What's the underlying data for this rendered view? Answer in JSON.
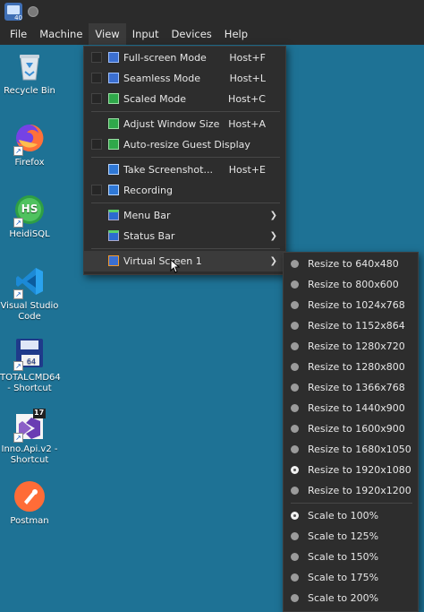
{
  "menubar": {
    "items": [
      "File",
      "Machine",
      "View",
      "Input",
      "Devices",
      "Help"
    ]
  },
  "app_icon_version": "40",
  "desktop": {
    "icons": [
      {
        "label": "Recycle Bin",
        "icon": "recycle-bin-icon"
      },
      {
        "label": "Firefox",
        "icon": "firefox-icon"
      },
      {
        "label": "HeidiSQL",
        "icon": "heidisql-icon",
        "badge": "HS"
      },
      {
        "label": "Visual Studio Code",
        "icon": "vscode-icon"
      },
      {
        "label": "TOTALCMD64 - Shortcut",
        "icon": "totalcmd-icon",
        "badge": "64"
      },
      {
        "label": "Inno.Api.v2 - Shortcut",
        "icon": "visual-studio-icon",
        "badge": "17"
      },
      {
        "label": "Postman",
        "icon": "postman-icon"
      }
    ]
  },
  "view_menu": {
    "items": [
      {
        "label": "Full-screen Mode",
        "shortcut": "Host+F",
        "icon": "fullscreen-icon"
      },
      {
        "label": "Seamless Mode",
        "shortcut": "Host+L",
        "icon": "seamless-icon"
      },
      {
        "label": "Scaled Mode",
        "shortcut": "Host+C",
        "icon": "scaled-icon"
      },
      {
        "label": "Adjust Window Size",
        "shortcut": "Host+A",
        "icon": "adjust-window-icon"
      },
      {
        "label": "Auto-resize Guest Display",
        "shortcut": "",
        "icon": "auto-resize-icon"
      },
      {
        "label": "Take Screenshot...",
        "shortcut": "Host+E",
        "icon": "screenshot-icon"
      },
      {
        "label": "Recording",
        "shortcut": "",
        "icon": "recording-icon"
      },
      {
        "label": "Menu Bar",
        "shortcut": "",
        "icon": "menu-bar-icon"
      },
      {
        "label": "Status Bar",
        "shortcut": "",
        "icon": "status-bar-icon"
      },
      {
        "label": "Virtual Screen 1",
        "shortcut": "",
        "icon": "virtual-screen-icon"
      }
    ]
  },
  "virtual_screen_menu": {
    "resize": [
      "Resize to 640x480",
      "Resize to 800x600",
      "Resize to 1024x768",
      "Resize to 1152x864",
      "Resize to 1280x720",
      "Resize to 1280x800",
      "Resize to 1366x768",
      "Resize to 1440x900",
      "Resize to 1600x900",
      "Resize to 1680x1050",
      "Resize to 1920x1080",
      "Resize to 1920x1200"
    ],
    "resize_selected": "Resize to 1920x1080",
    "scale": [
      "Scale to 100%",
      "Scale to 125%",
      "Scale to 150%",
      "Scale to 175%",
      "Scale to 200%"
    ],
    "scale_selected": "Scale to 100%"
  },
  "colors": {
    "desktop": "#1e7295",
    "menu_bg": "#2d2d2d",
    "titlebar": "#2b2b2b"
  }
}
